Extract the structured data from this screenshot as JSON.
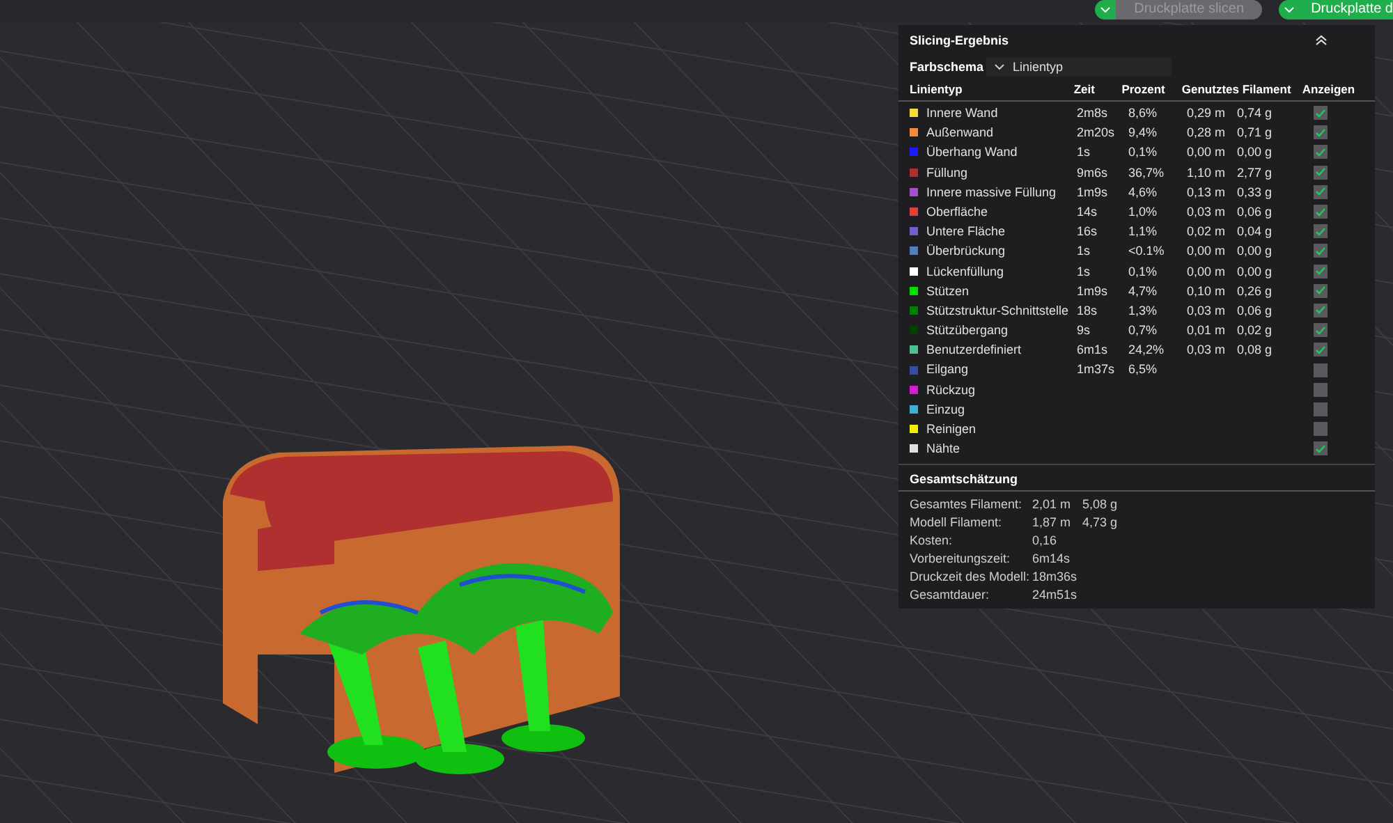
{
  "toolbar": {
    "buttons": [
      {
        "label": "Druckplatte slicen",
        "disabled": true
      },
      {
        "label": "Druckplatte d",
        "disabled": false
      }
    ]
  },
  "panel": {
    "title": "Slicing-Ergebnis",
    "color_scheme": {
      "label": "Farbschema",
      "value": "Linientyp"
    },
    "columns": [
      "Linientyp",
      "Zeit",
      "Prozent",
      "Genutztes Filament",
      "Anzeigen"
    ],
    "rows": [
      {
        "name": "Innere Wand",
        "color": "#f0dc3c",
        "time": "2m8s",
        "percent": "8,6%",
        "length": "0,29 m",
        "weight": "0,74 g",
        "checked": true
      },
      {
        "name": "Außenwand",
        "color": "#f08a3c",
        "time": "2m20s",
        "percent": "9,4%",
        "length": "0,28 m",
        "weight": "0,71 g",
        "checked": true
      },
      {
        "name": "Überhang Wand",
        "color": "#1a1aff",
        "time": "1s",
        "percent": "0,1%",
        "length": "0,00 m",
        "weight": "0,00 g",
        "checked": true
      },
      {
        "name": "Füllung",
        "color": "#b03030",
        "time": "9m6s",
        "percent": "36,7%",
        "length": "1,10 m",
        "weight": "2,77 g",
        "checked": true
      },
      {
        "name": "Innere massive Füllung",
        "color": "#a050d0",
        "time": "1m9s",
        "percent": "4,6%",
        "length": "0,13 m",
        "weight": "0,33 g",
        "checked": true
      },
      {
        "name": "Oberfläche",
        "color": "#e04040",
        "time": "14s",
        "percent": "1,0%",
        "length": "0,03 m",
        "weight": "0,06 g",
        "checked": true
      },
      {
        "name": "Untere Fläche",
        "color": "#7060d0",
        "time": "16s",
        "percent": "1,1%",
        "length": "0,02 m",
        "weight": "0,04 g",
        "checked": true
      },
      {
        "name": "Überbrückung",
        "color": "#5080c0",
        "time": "1s",
        "percent": "<0.1%",
        "length": "0,00 m",
        "weight": "0,00 g",
        "checked": true
      },
      {
        "name": "Lückenfüllung",
        "color": "#ffffff",
        "time": "1s",
        "percent": "0,1%",
        "length": "0,00 m",
        "weight": "0,00 g",
        "checked": true
      },
      {
        "name": "Stützen",
        "color": "#00e000",
        "time": "1m9s",
        "percent": "4,7%",
        "length": "0,10 m",
        "weight": "0,26 g",
        "checked": true
      },
      {
        "name": "Stützstruktur-Schnittstelle",
        "color": "#008000",
        "time": "18s",
        "percent": "1,3%",
        "length": "0,03 m",
        "weight": "0,06 g",
        "checked": true
      },
      {
        "name": "Stützübergang",
        "color": "#004000",
        "time": "9s",
        "percent": "0,7%",
        "length": "0,01 m",
        "weight": "0,02 g",
        "checked": true
      },
      {
        "name": "Benutzerdefiniert",
        "color": "#50c090",
        "time": "6m1s",
        "percent": "24,2%",
        "length": "0,03 m",
        "weight": "0,08 g",
        "checked": true
      },
      {
        "name": "Eilgang",
        "color": "#3050a0",
        "time": "1m37s",
        "percent": "6,5%",
        "checked": false
      },
      {
        "name": "Rückzug",
        "color": "#d020d0",
        "checked": false
      },
      {
        "name": "Einzug",
        "color": "#40b0d0",
        "checked": false
      },
      {
        "name": "Reinigen",
        "color": "#f0f000",
        "checked": false
      },
      {
        "name": "Nähte",
        "color": "#e0e0e0",
        "checked": true
      }
    ],
    "summary": {
      "title": "Gesamtschätzung",
      "items": [
        {
          "label": "Gesamtes Filament:",
          "values": [
            "2,01 m",
            "5,08 g"
          ]
        },
        {
          "label": "Modell Filament:",
          "values": [
            "1,87 m",
            "4,73 g"
          ]
        },
        {
          "label": "Kosten:",
          "values": [
            "0,16"
          ]
        },
        {
          "label": "Vorbereitungszeit:",
          "values": [
            "6m14s"
          ]
        },
        {
          "label": "Druckzeit des Modell:",
          "values": [
            "18m36s"
          ]
        },
        {
          "label": "Gesamtdauer:",
          "values": [
            "24m51s"
          ]
        }
      ]
    }
  }
}
